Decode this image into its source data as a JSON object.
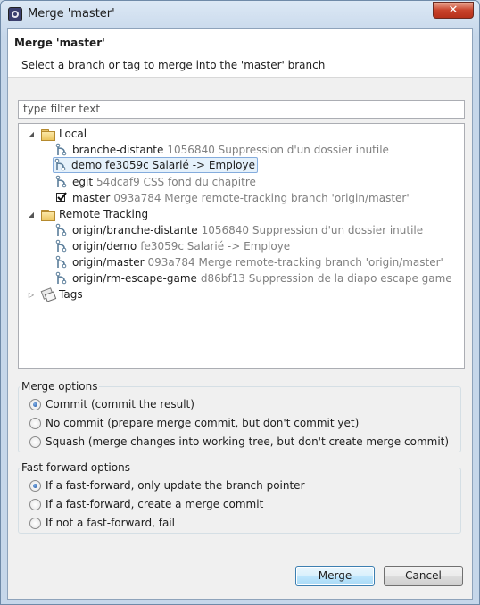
{
  "window": {
    "title": "Merge 'master'",
    "close_glyph": "✕"
  },
  "header": {
    "title": "Merge 'master'",
    "description": "Select a branch or tag to merge into the 'master' branch"
  },
  "filter": {
    "placeholder": "type filter text",
    "value": ""
  },
  "tree": {
    "local": {
      "label": "Local",
      "expand_glyph": "◢",
      "items": [
        {
          "name": "branche-distante",
          "info": "1056840 Suppression d'un dossier inutile",
          "icon": "branch-icon"
        },
        {
          "name": "demo",
          "info": "fe3059c Salarié -> Employe",
          "icon": "branch-icon",
          "selected": true
        },
        {
          "name": "egit",
          "info": "54dcaf9 CSS fond du chapitre",
          "icon": "branch-icon"
        },
        {
          "name": "master",
          "info": "093a784 Merge remote-tracking branch 'origin/master'",
          "icon": "checked-out-branch-icon"
        }
      ]
    },
    "remote": {
      "label": "Remote Tracking",
      "expand_glyph": "◢",
      "items": [
        {
          "name": "origin/branche-distante",
          "info": "1056840 Suppression d'un dossier inutile",
          "icon": "remote-branch-icon"
        },
        {
          "name": "origin/demo",
          "info": "fe3059c Salarié -> Employe",
          "icon": "remote-branch-icon"
        },
        {
          "name": "origin/master",
          "info": "093a784 Merge remote-tracking branch 'origin/master'",
          "icon": "remote-branch-icon"
        },
        {
          "name": "origin/rm-escape-game",
          "info": "d86bf13 Suppression de la diapo escape game",
          "icon": "remote-branch-icon"
        }
      ]
    },
    "tags": {
      "label": "Tags",
      "expand_glyph": "▷"
    }
  },
  "merge_options": {
    "title": "Merge options",
    "options": [
      {
        "label": "Commit (commit the result)",
        "selected": true
      },
      {
        "label": "No commit (prepare merge commit, but don't commit yet)",
        "selected": false
      },
      {
        "label": "Squash (merge changes into working tree, but don't create merge commit)",
        "selected": false
      }
    ]
  },
  "ff_options": {
    "title": "Fast forward options",
    "options": [
      {
        "label": "If a fast-forward, only update the branch pointer",
        "selected": true
      },
      {
        "label": "If a fast-forward, create a merge commit",
        "selected": false
      },
      {
        "label": "If not a fast-forward, fail",
        "selected": false
      }
    ]
  },
  "buttons": {
    "merge": "Merge",
    "cancel": "Cancel"
  },
  "colors": {
    "selection_bg": "#e5f1fb",
    "selection_border": "#84acdd",
    "info_text": "#808080",
    "radio_dot": "#1c4f9c"
  }
}
